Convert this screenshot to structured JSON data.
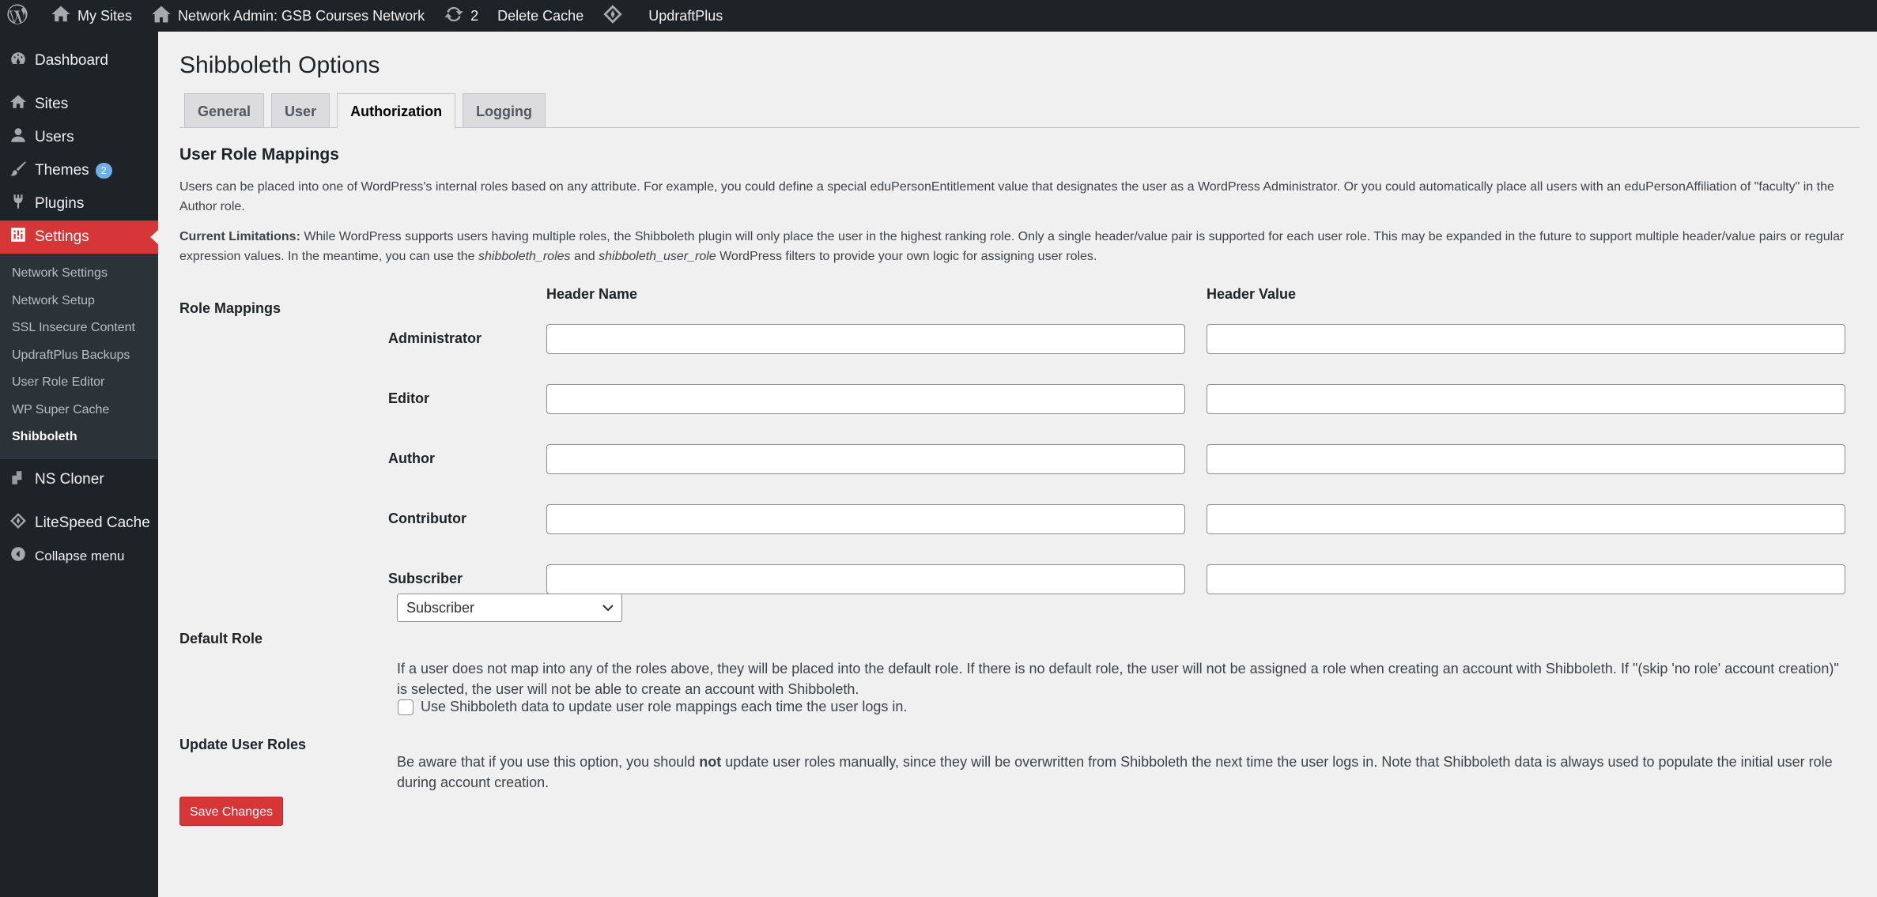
{
  "adminbar": {
    "my_sites": "My Sites",
    "network_admin": "Network Admin: GSB Courses Network",
    "updates_count": "2",
    "delete_cache": "Delete Cache",
    "updraftplus": "UpdraftPlus"
  },
  "sidebar": {
    "dashboard": "Dashboard",
    "sites": "Sites",
    "users": "Users",
    "themes": "Themes",
    "themes_badge": "2",
    "plugins": "Plugins",
    "settings": "Settings",
    "submenu": [
      "Network Settings",
      "Network Setup",
      "SSL Insecure Content",
      "UpdraftPlus Backups",
      "User Role Editor",
      "WP Super Cache",
      "Shibboleth"
    ],
    "ns_cloner": "NS Cloner",
    "litespeed": "LiteSpeed Cache",
    "collapse": "Collapse menu",
    "current_color": "#d63638"
  },
  "page": {
    "title": "Shibboleth Options",
    "tabs": [
      "General",
      "User",
      "Authorization",
      "Logging"
    ],
    "active_tab": "Authorization",
    "section_title": "User Role Mappings",
    "intro": "Users can be placed into one of WordPress's internal roles based on any attribute. For example, you could define a special eduPersonEntitlement value that designates the user as a WordPress Administrator. Or you could automatically place all users with an eduPersonAffiliation of \"faculty\" in the Author role.",
    "limitations_label": "Current Limitations:",
    "limitations_text_1": " While WordPress supports users having multiple roles, the Shibboleth plugin will only place the user in the highest ranking role. Only a single header/value pair is supported for each user role. This may be expanded in the future to support multiple header/value pairs or regular expression values. In the meantime, you can use the ",
    "limitations_em_1": "shibboleth_roles",
    "limitations_text_2": " and ",
    "limitations_em_2": "shibboleth_user_role",
    "limitations_text_3": " WordPress filters to provide your own logic for assigning user roles.",
    "role_mappings_label": "Role Mappings",
    "header_name_col": "Header Name",
    "header_value_col": "Header Value",
    "roles": [
      "Administrator",
      "Editor",
      "Author",
      "Contributor",
      "Subscriber"
    ],
    "role_header_names": [
      "",
      "",
      "",
      "",
      ""
    ],
    "role_header_values": [
      "",
      "",
      "",
      "",
      ""
    ],
    "default_role_label": "Default Role",
    "default_role_value": "Subscriber",
    "default_role_help": "If a user does not map into any of the roles above, they will be placed into the default role. If there is no default role, the user will not be assigned a role when creating an account with Shibboleth. If \"(skip 'no role' account creation)\" is selected, the user will not be able to create an account with Shibboleth.",
    "update_roles_label": "Update User Roles",
    "update_roles_checkbox": "Use Shibboleth data to update user role mappings each time the user logs in.",
    "update_roles_checked": false,
    "update_help_1": "Be aware that if you use this option, you should ",
    "update_help_bold": "not",
    "update_help_2": " update user roles manually, since they will be overwritten from Shibboleth the next time the user logs in. Note that Shibboleth data is always used to populate the initial user role during account creation.",
    "save_button": "Save Changes"
  }
}
